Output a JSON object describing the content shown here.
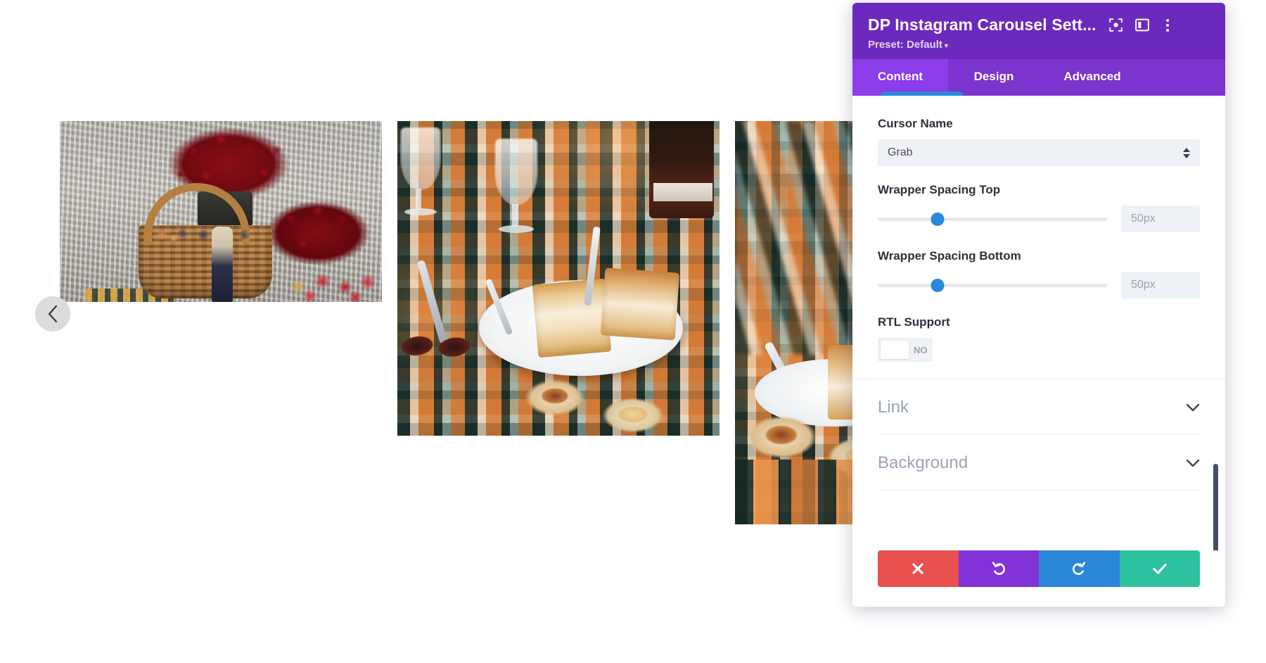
{
  "panel": {
    "title": "DP Instagram Carousel Sett...",
    "preset_label": "Preset: Default",
    "preset_caret": "▾",
    "icons": {
      "focus": "focus-target-icon",
      "layout": "panel-layout-icon",
      "more": "more-vertical-icon"
    },
    "tabs": [
      {
        "label": "Content",
        "active": true
      },
      {
        "label": "Design",
        "active": false
      },
      {
        "label": "Advanced",
        "active": false
      }
    ],
    "fields": {
      "cursor_name": {
        "label": "Cursor Name",
        "value": "Grab"
      },
      "wrapper_spacing_top": {
        "label": "Wrapper Spacing Top",
        "value": "",
        "placeholder": "50px",
        "slider_percent": 26
      },
      "wrapper_spacing_bottom": {
        "label": "Wrapper Spacing Bottom",
        "value": "",
        "placeholder": "50px",
        "slider_percent": 26
      },
      "rtl_support": {
        "label": "RTL Support",
        "state_label": "NO",
        "enabled": false
      }
    },
    "accordions": [
      {
        "label": "Link",
        "expanded": false
      },
      {
        "label": "Background",
        "expanded": false
      }
    ],
    "footer": [
      {
        "name": "cancel",
        "icon": "close-icon",
        "color": "#e8504e"
      },
      {
        "name": "undo",
        "icon": "undo-icon",
        "color": "#8232d6"
      },
      {
        "name": "redo",
        "icon": "redo-icon",
        "color": "#2b87da"
      },
      {
        "name": "save",
        "icon": "check-icon",
        "color": "#2ec1a0"
      }
    ],
    "colors": {
      "header": "#6c29bd",
      "tabbar": "#7b34ce",
      "tab_active": "#8c3ce8",
      "accent_blue": "#2b87da",
      "scrollbar": "#44505f"
    }
  },
  "carousel": {
    "prev_button": "chevron-left-icon",
    "slides": [
      {
        "alt": "Wicker basket of plums and peaches with red chrysanthemums, champagne bottle and apples on gravel"
      },
      {
        "alt": "Picnic blanket with cake slices on a white plate, wine glasses, wine bottle and custard tarts"
      },
      {
        "alt": "Picnic blanket close-up with cake slice on plate and two custard tarts"
      }
    ]
  }
}
